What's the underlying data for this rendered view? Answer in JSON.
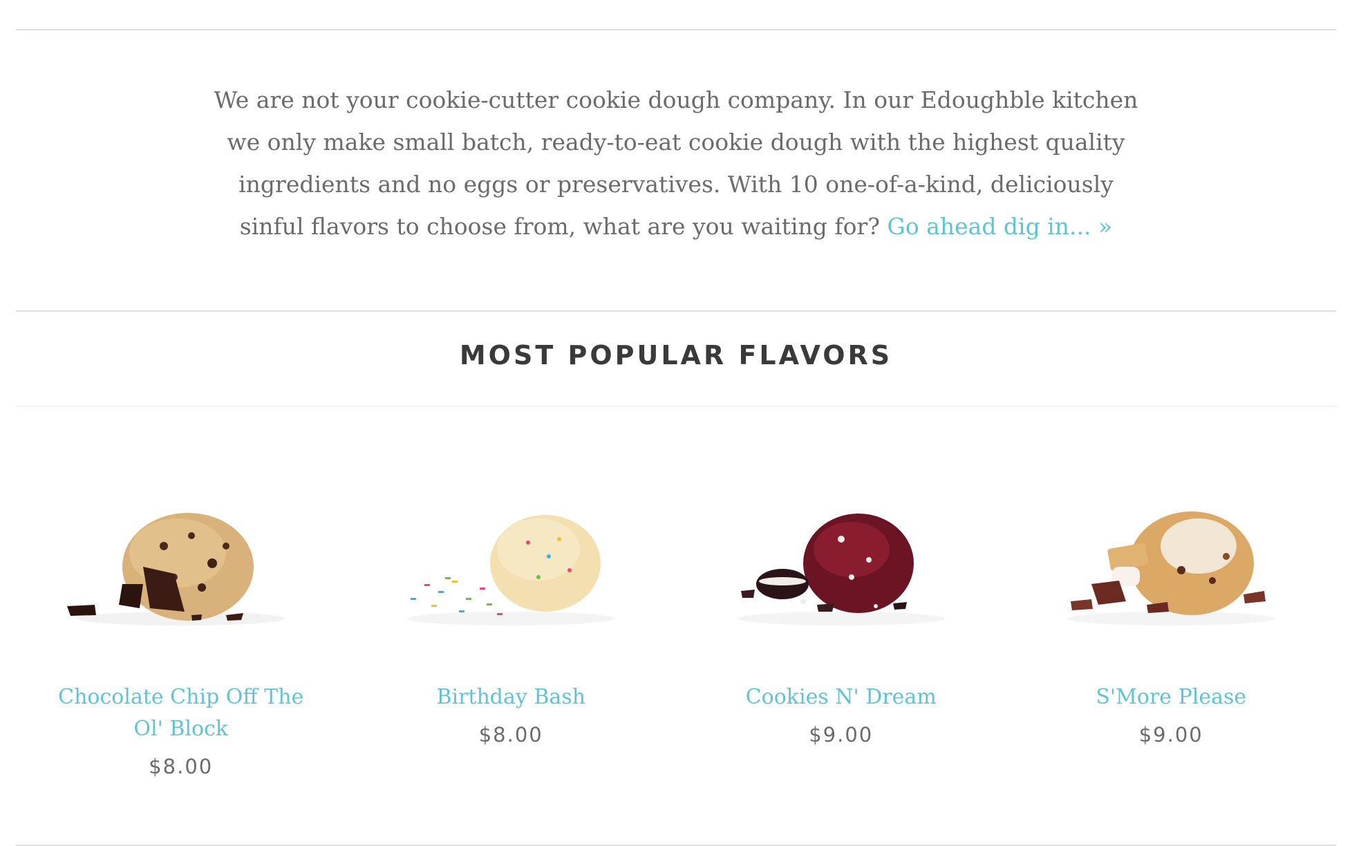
{
  "intro": {
    "text": "We are not your cookie-cutter cookie dough company. In our Edoughble kitchen we only make small batch, ready-to-eat cookie dough with the highest quality ingredients and no eggs or preservatives. With 10 one-of-a-kind, deliciously sinful flavors to choose from, what are you waiting for? ",
    "link_label": "Go ahead dig in... »"
  },
  "section": {
    "title": "MOST POPULAR FLAVORS"
  },
  "products": [
    {
      "name": "Chocolate Chip Off The Ol' Block",
      "price": "$8.00",
      "image": "chocolate-chip-dough-image"
    },
    {
      "name": "Birthday Bash",
      "price": "$8.00",
      "image": "birthday-bash-dough-image"
    },
    {
      "name": "Cookies N' Dream",
      "price": "$9.00",
      "image": "cookies-n-dream-dough-image"
    },
    {
      "name": "S'More Please",
      "price": "$9.00",
      "image": "smore-please-dough-image"
    }
  ],
  "colors": {
    "link": "#5fc3d5",
    "text": "#6b6b6b",
    "heading": "#3a3a3a",
    "divider": "#dedede"
  }
}
